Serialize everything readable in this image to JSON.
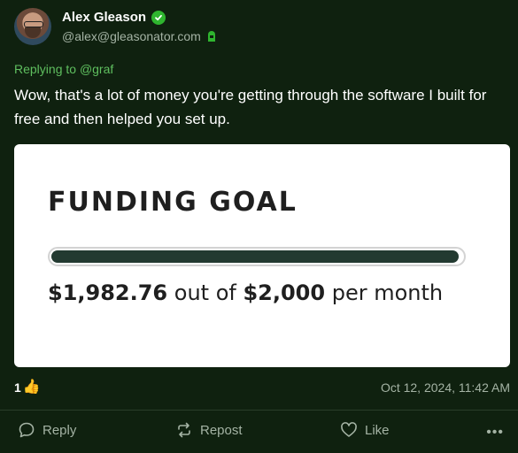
{
  "post": {
    "author": {
      "display_name": "Alex Gleason",
      "handle": "@alex@gleasonator.com"
    },
    "replying_prefix": "Replying to ",
    "replying_to": "@graf",
    "body": "Wow, that's a lot of money you're getting through the software I built for free and then helped you set up.",
    "card": {
      "title": "FUNDING GOAL",
      "progress_fraction": 0.991,
      "amount_current": "$1,982.76",
      "amount_mid": " out of ",
      "amount_goal": "$2,000",
      "amount_suffix": " per month"
    },
    "likes": "1",
    "timestamp": "Oct 12, 2024, 11:42 AM"
  },
  "actions": {
    "reply": "Reply",
    "repost": "Repost",
    "like": "Like"
  },
  "icons": {
    "verified": "check-badge-icon",
    "site": "site-badge-icon",
    "thumb": "thumbs-up-icon",
    "reply": "speech-bubble-icon",
    "repost": "repost-arrows-icon",
    "like": "heart-icon",
    "more": "more-dots-icon"
  },
  "colors": {
    "background": "#0f210f",
    "accent": "#5fbf5f",
    "muted": "#a4b3a4",
    "verified": "#2fb52f",
    "progress": "#233a31"
  }
}
